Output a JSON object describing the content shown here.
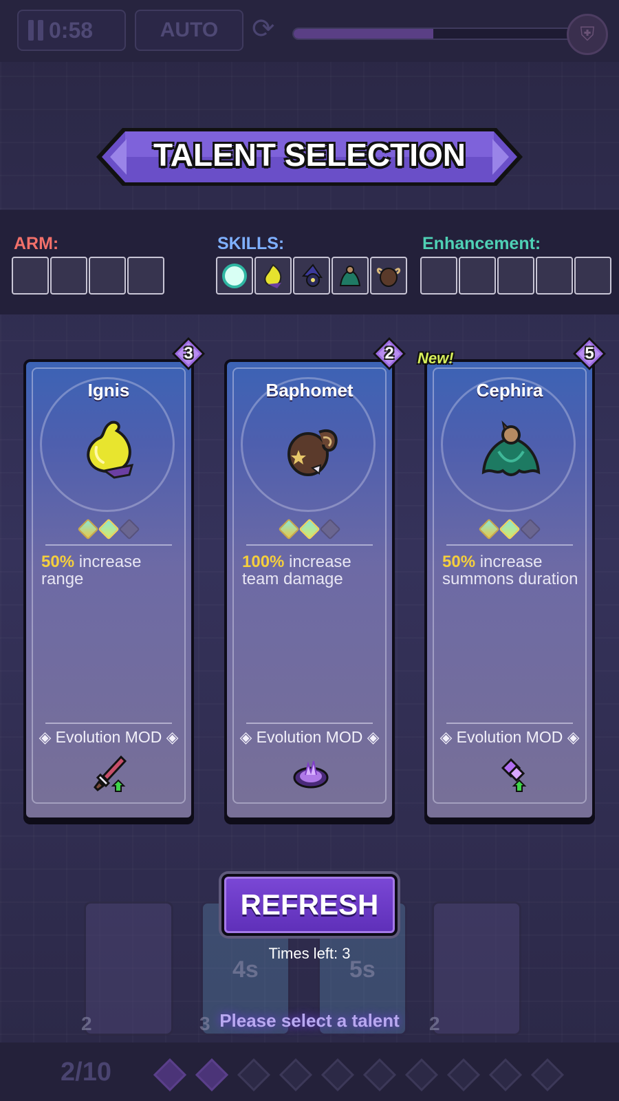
{
  "hud": {
    "timer": "0:58",
    "auto_label": "AUTO",
    "boss_progress": 0.5
  },
  "title": "TALENT SELECTION",
  "loadout": {
    "arm_label": "ARM:",
    "skills_label": "SKILLS:",
    "enhancement_label": "Enhancement:",
    "arm_slots": 4,
    "skill_icons": [
      "orb-icon",
      "ignis-icon",
      "wizard-icon",
      "cephira-icon",
      "baphomet-icon"
    ],
    "enhancement_slots": 5,
    "colors": {
      "arm": "#f2706a",
      "skills": "#7fb0ff",
      "enhancement": "#4fd1b5"
    }
  },
  "cards": [
    {
      "name": "Ignis",
      "level": "3",
      "new": "",
      "pct": "50%",
      "desc": " increase range",
      "evo_label": "Evolution MOD",
      "evo_icon": "dagger-upgrade-icon",
      "art_icon": "yellow-flame-icon"
    },
    {
      "name": "Baphomet",
      "level": "2",
      "new": "",
      "pct": "100%",
      "desc": " increase team damage",
      "evo_label": "Evolution MOD",
      "evo_icon": "purple-portal-icon",
      "art_icon": "goat-head-icon"
    },
    {
      "name": "Cephira",
      "level": "5",
      "new": "New!",
      "pct": "50%",
      "desc": " increase summons duration",
      "evo_label": "Evolution MOD",
      "evo_icon": "crystal-upgrade-icon",
      "art_icon": "green-cloak-icon"
    }
  ],
  "refresh": {
    "label": "REFRESH",
    "times_left": "Times left: 3"
  },
  "bg_timers": [
    "4s",
    "5s"
  ],
  "bg_card_levels": [
    "2",
    "3",
    "2"
  ],
  "prompt": "Please select a talent",
  "wave": "2/10"
}
